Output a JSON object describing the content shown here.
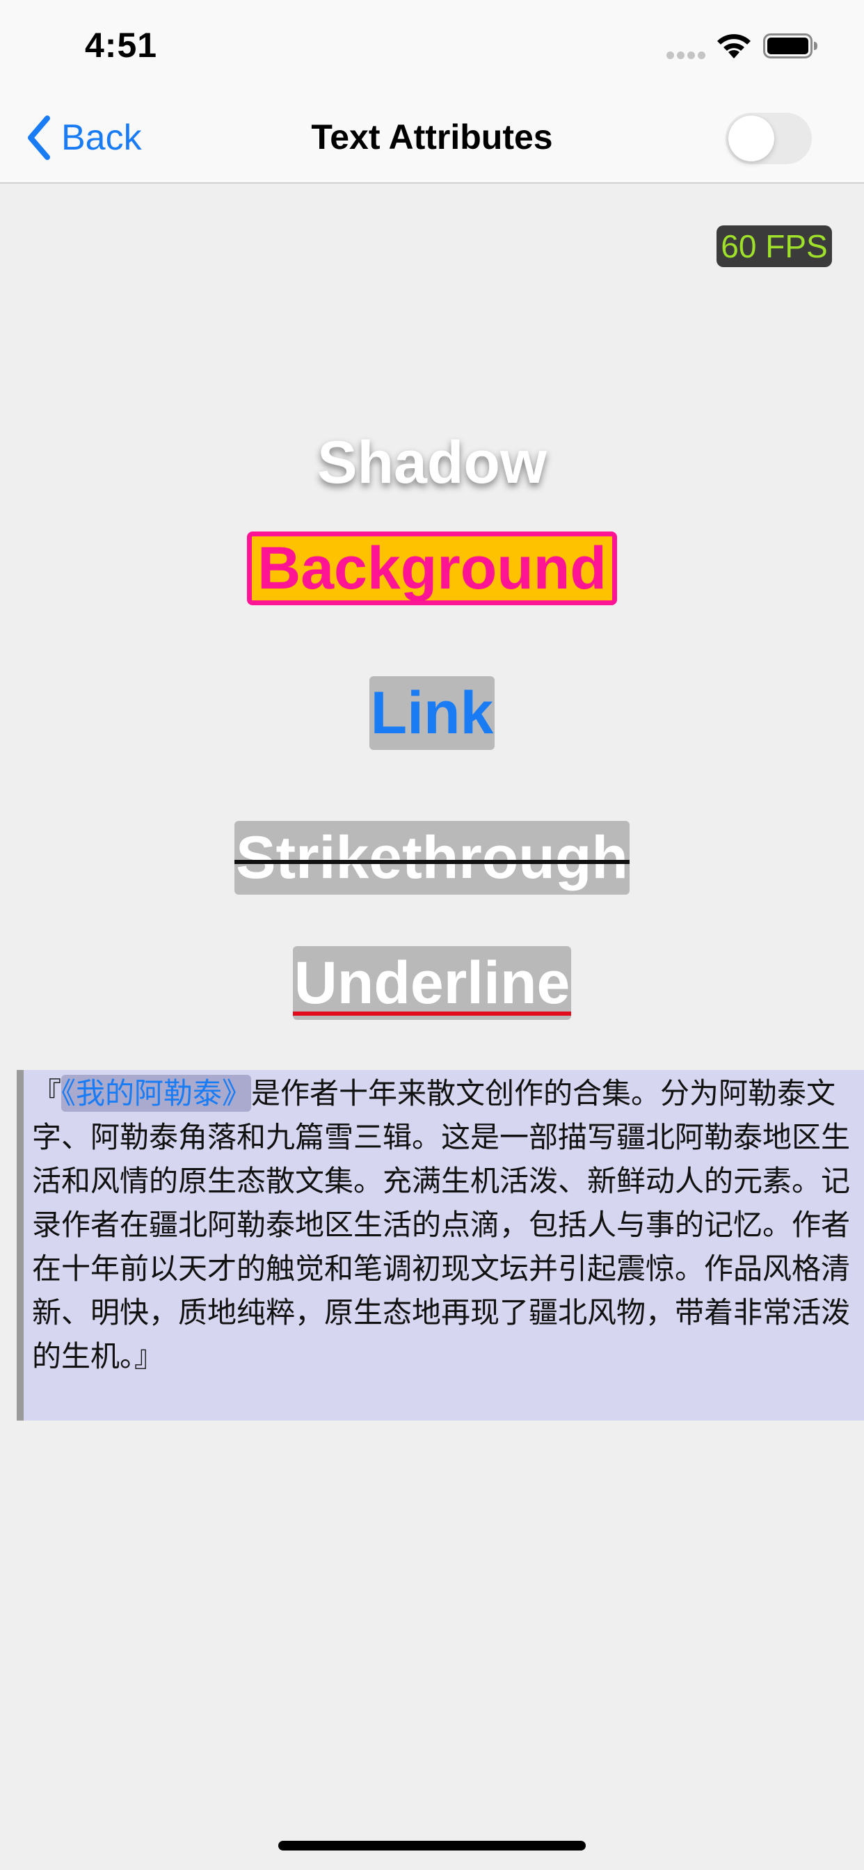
{
  "status_bar": {
    "time": "4:51"
  },
  "nav": {
    "back_label": "Back",
    "title": "Text Attributes",
    "toggle_on": false
  },
  "fps_badge": "60 FPS",
  "labels": {
    "shadow": "Shadow",
    "background": "Background",
    "link": "Link",
    "strikethrough": "Strikethrough",
    "underline": "Underline"
  },
  "paragraph": {
    "open_quote": "『",
    "book_title": "《我的阿勒泰》",
    "body": "是作者十年来散文创作的合集。分为阿勒泰文字、阿勒泰角落和九篇雪三辑。这是一部描写疆北阿勒泰地区生活和风情的原生态散文集。充满生机活泼、新鲜动人的元素。记录作者在疆北阿勒泰地区生活的点滴，包括人与事的记忆。作者在十年前以天才的触觉和笔调初现文坛并引起震惊。作品风格清新、明快，质地纯粹，原生态地再现了疆北风物，带着非常活泼的生机。",
    "close_quote": "』"
  },
  "colors": {
    "accent": "#1a7cf4",
    "fps_text": "#9fe02a",
    "background_fill": "#ffc200",
    "background_text": "#ff1493",
    "underline": "#e10b1c",
    "quote_bg": "#d6d6f0"
  }
}
